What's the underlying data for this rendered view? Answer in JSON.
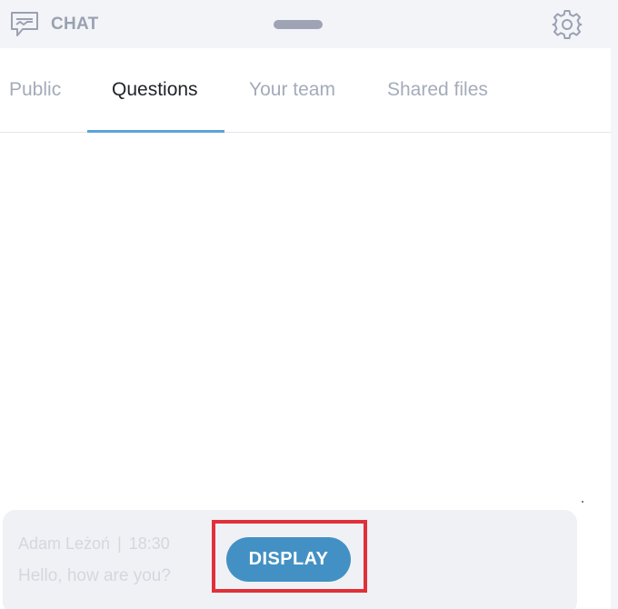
{
  "header": {
    "title": "CHAT",
    "chat_icon": "chat-bubble-icon",
    "settings_icon": "gear-icon"
  },
  "tabs": [
    {
      "label": "Public",
      "active": false
    },
    {
      "label": "Questions",
      "active": true
    },
    {
      "label": "Your team",
      "active": false
    },
    {
      "label": "Shared files",
      "active": false
    }
  ],
  "message": {
    "author": "Adam Leżoń",
    "separator": "|",
    "time": "18:30",
    "text": "Hello, how are you?",
    "display_label": "DISPLAY"
  },
  "colors": {
    "accent": "#4391c4",
    "tab_underline": "#5ba3d6",
    "highlight": "#e0303a"
  }
}
